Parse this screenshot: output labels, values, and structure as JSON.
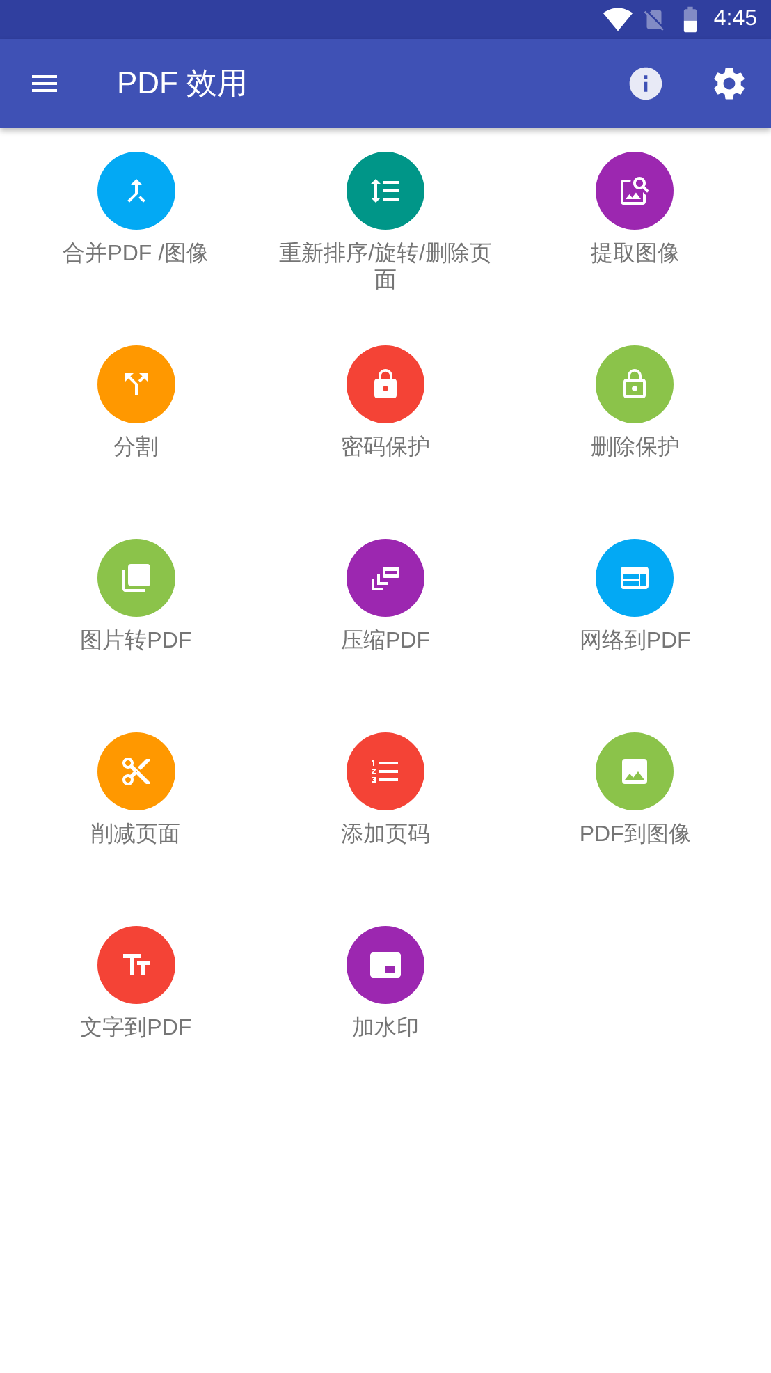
{
  "status_bar": {
    "time": "4:45"
  },
  "app_bar": {
    "title": "PDF 效用"
  },
  "tools": [
    {
      "label": "合并PDF /图像",
      "kind": "merge",
      "color": "#03a9f4"
    },
    {
      "label": "重新排序/旋转/删除页面",
      "kind": "reorder",
      "color": "#009688"
    },
    {
      "label": "提取图像",
      "kind": "extract",
      "color": "#9c27b0"
    },
    {
      "label": "分割",
      "kind": "split",
      "color": "#ff9800"
    },
    {
      "label": "密码保护",
      "kind": "lock",
      "color": "#f44336"
    },
    {
      "label": "删除保护",
      "kind": "unlock",
      "color": "#8bc34a"
    },
    {
      "label": "图片转PDF",
      "kind": "convert",
      "color": "#8bc34a"
    },
    {
      "label": "压缩PDF",
      "kind": "compress",
      "color": "#9c27b0"
    },
    {
      "label": "网络到PDF",
      "kind": "web",
      "color": "#03a9f4"
    },
    {
      "label": "削减页面",
      "kind": "cut",
      "color": "#ff9800"
    },
    {
      "label": "添加页码",
      "kind": "number",
      "color": "#f44336"
    },
    {
      "label": "PDF到图像",
      "kind": "image",
      "color": "#8bc34a"
    },
    {
      "label": "文字到PDF",
      "kind": "text",
      "color": "#f44336"
    },
    {
      "label": "加水印",
      "kind": "watermark",
      "color": "#9c27b0"
    }
  ]
}
